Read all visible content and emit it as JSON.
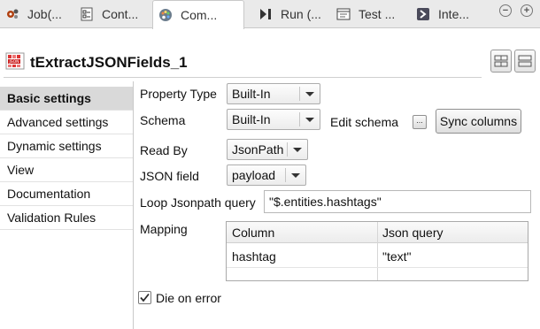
{
  "tabs": [
    {
      "label": "Job(...",
      "icon": "job-icon"
    },
    {
      "label": "Cont...",
      "icon": "contexts-icon"
    },
    {
      "label": "Com...",
      "icon": "component-icon",
      "active": true
    },
    {
      "label": "Run (...",
      "icon": "run-icon"
    },
    {
      "label": "Test ...",
      "icon": "test-icon"
    },
    {
      "label": "Inte...",
      "icon": "integration-icon"
    }
  ],
  "window": {
    "minimize": "−",
    "maximize": "+"
  },
  "component": {
    "title": "tExtractJSONFields_1",
    "icon": "json-component-icon"
  },
  "nav": [
    {
      "label": "Basic settings",
      "active": true
    },
    {
      "label": "Advanced settings"
    },
    {
      "label": "Dynamic settings"
    },
    {
      "label": "View"
    },
    {
      "label": "Documentation"
    },
    {
      "label": "Validation Rules"
    }
  ],
  "form": {
    "property_type_label": "Property Type",
    "property_type_value": "Built-In",
    "schema_label": "Schema",
    "schema_value": "Built-In",
    "edit_schema_label": "Edit schema",
    "edit_schema_button": "...",
    "sync_columns_button": "Sync columns",
    "read_by_label": "Read By",
    "read_by_value": "JsonPath",
    "json_field_label": "JSON field",
    "json_field_value": "payload",
    "loop_label": "Loop Jsonpath query",
    "loop_value": "\"$.entities.hashtags\"",
    "mapping_label": "Mapping",
    "die_on_error_label": "Die on error",
    "die_on_error_checked": true
  },
  "mapping_table": {
    "columns": [
      "Column",
      "Json query"
    ],
    "rows": [
      [
        "hashtag",
        "\"text\""
      ]
    ]
  },
  "colors": {
    "active_tab_bg": "#ffffff",
    "tabbar_bg": "#eaeaea",
    "nav_active_bg": "#d9d9d9"
  }
}
